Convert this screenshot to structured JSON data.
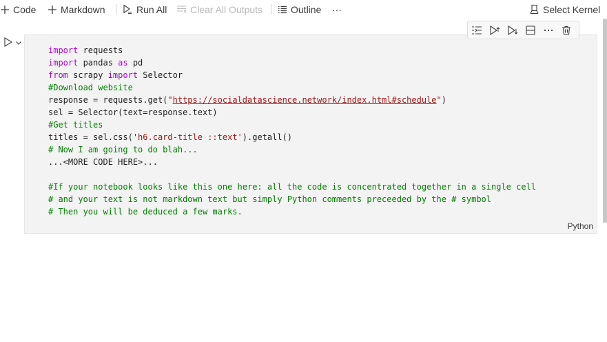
{
  "toolbar": {
    "code_label": "Code",
    "markdown_label": "Markdown",
    "run_all_label": "Run All",
    "clear_outputs_label": "Clear All Outputs",
    "outline_label": "Outline",
    "more_label": "···",
    "select_kernel_label": "Select Kernel"
  },
  "cell": {
    "language": "Python",
    "code": {
      "l1": {
        "kw": "import",
        "rest": " requests"
      },
      "l2": {
        "kw1": "import",
        "mid": " pandas ",
        "kw2": "as",
        "rest": " pd"
      },
      "l3": {
        "kw1": "from",
        "mid": " scrapy ",
        "kw2": "import",
        "rest": " Selector"
      },
      "l4": "#Download website",
      "l5": {
        "pre": "response = requests.get(",
        "q1": "\"",
        "url": "https://socialdatascience.network/index.html#schedule",
        "q2": "\"",
        "post": ")"
      },
      "l6": "sel = Selector(text=response.text)",
      "l7": "#Get titles",
      "l8": {
        "pre": "titles = sel.css(",
        "str": "'h6.card-title ::text'",
        "post": ").getall()"
      },
      "l9": "# Now I am going to do blah...",
      "l10": "...<MORE CODE HERE>...",
      "l12": "#If your notebook looks like this one here: all the code is concentrated together in a single cell",
      "l13": "# and your text is not markdown text but simply Python comments preceeded by the # symbol",
      "l14": "# Then you will be deduced a few marks."
    }
  }
}
